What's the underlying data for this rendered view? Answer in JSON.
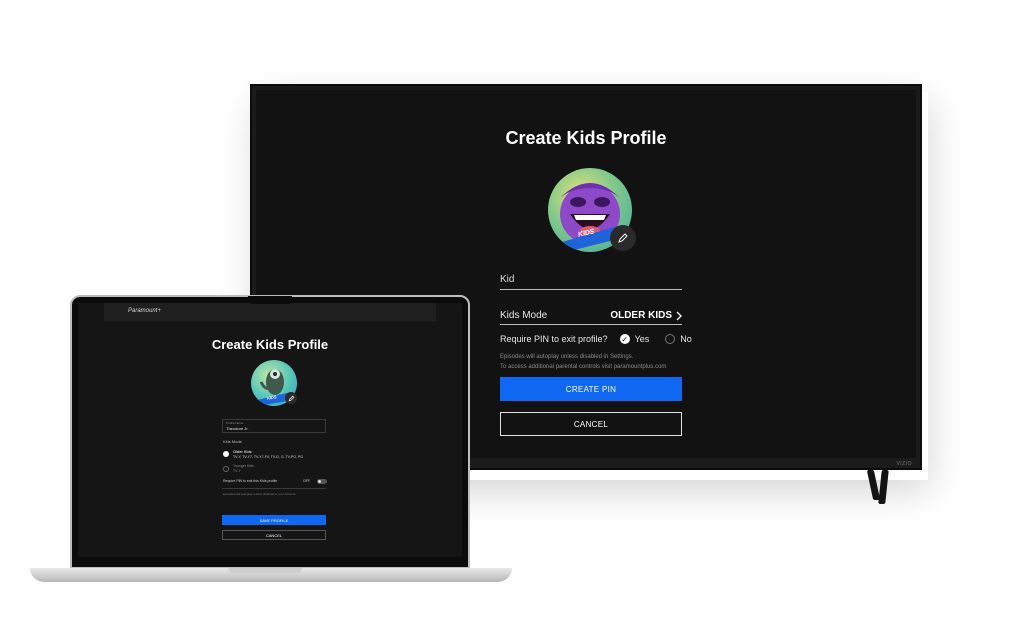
{
  "tv": {
    "title": "Create Kids Profile",
    "avatar_badge": "KIDS",
    "name_value": "Kid",
    "kids_mode_label": "Kids Mode",
    "kids_mode_value": "OLDER KIDS",
    "pin_question": "Require PIN to exit profile?",
    "pin_yes": "Yes",
    "pin_no": "No",
    "note_1": "Episodes will autoplay unless disabled in Settings.",
    "note_2": "To access additional parental controls visit paramountplus.com",
    "create_pin_label": "CREATE PIN",
    "cancel_label": "CANCEL",
    "brand": "VIZIO",
    "accent": "#0f67f2"
  },
  "laptop": {
    "logo": "Paramount+",
    "title": "Create Kids Profile",
    "avatar_badge": "KIDS",
    "name_label": "Profile Name",
    "name_value": "Theodore Jr.",
    "kids_mode_label": "Kids Mode",
    "older_kids_label": "Older Kids",
    "older_kids_ratings": "TV-Y, TV-Y7, TV-Y7-FV, TV-G, G, TV-PG, PG",
    "younger_kids_label": "Younger Kids",
    "younger_kids_ratings": "TV-Y",
    "pin_question": "Require PIN to exit this Kids profile",
    "pin_toggle": "OFF",
    "note": "Episodes will autoplay unless disabled in your Account.",
    "save_label": "SAVE PROFILE",
    "cancel_label": "CANCEL"
  }
}
